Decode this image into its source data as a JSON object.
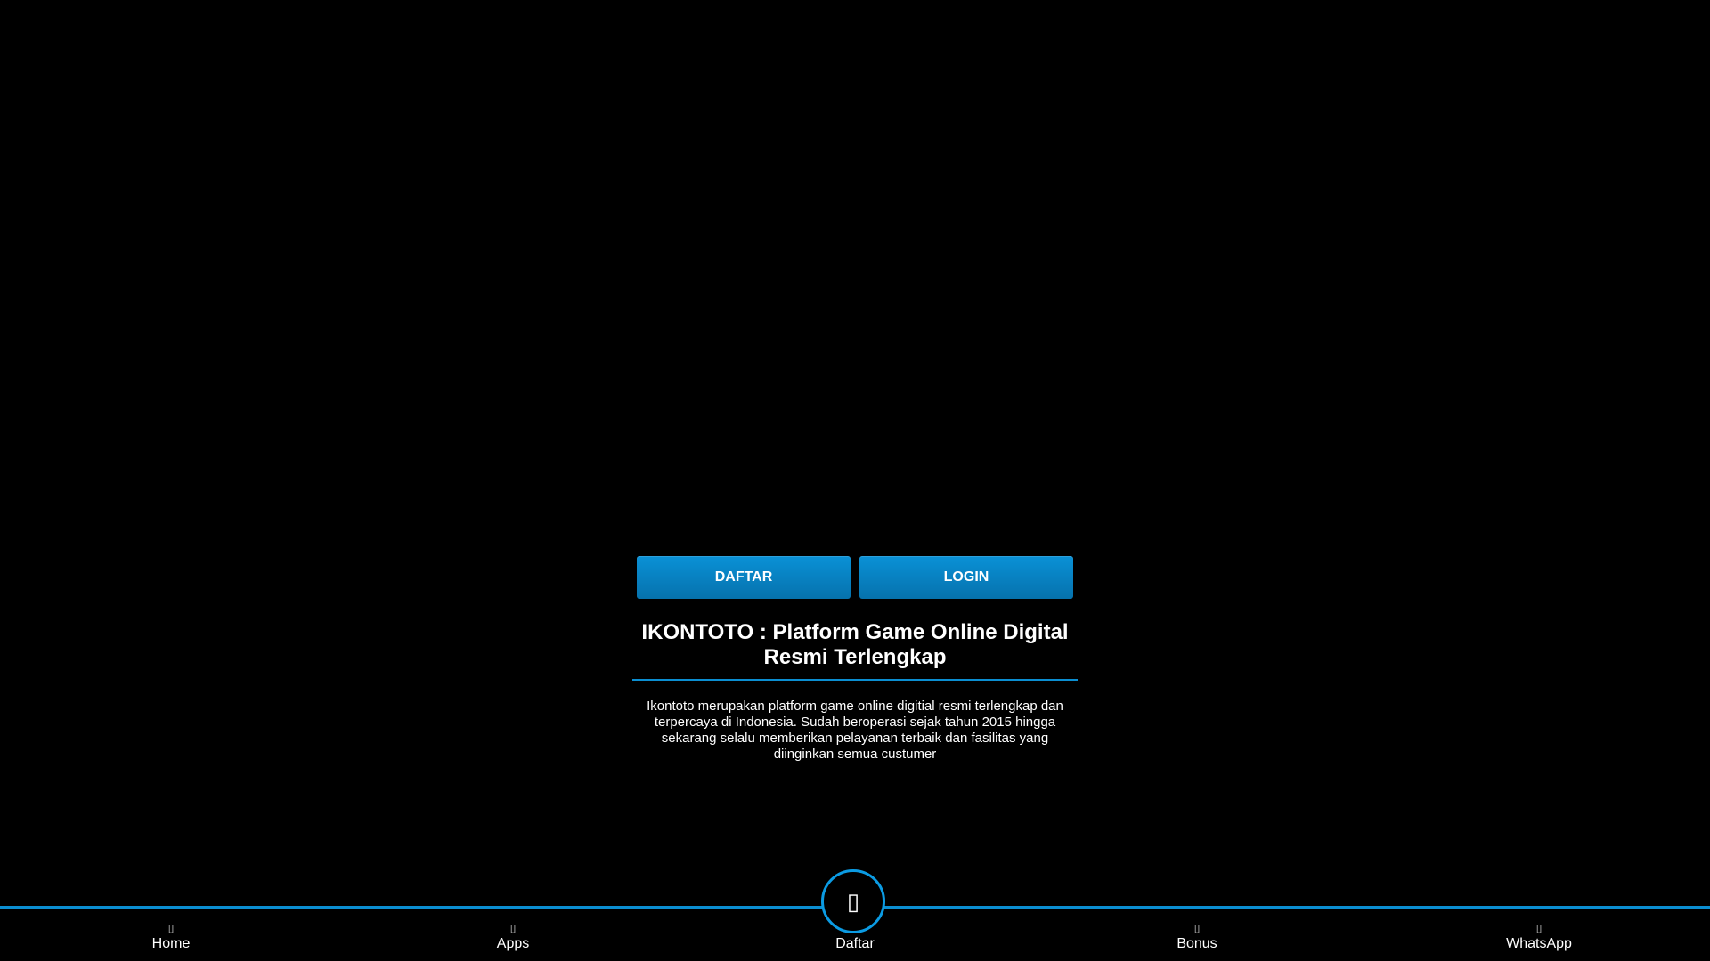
{
  "hero": {
    "buttons": {
      "register_label": "DAFTAR",
      "login_label": "LOGIN"
    }
  },
  "content": {
    "title": "IKONTOTO : Platform Game Online Digital Resmi Terlengkap",
    "description": "Ikontoto merupakan platform game online digitial resmi terlengkap dan terpercaya di Indonesia. Sudah beroperasi sejak tahun 2015 hingga sekarang selalu memberikan pelayanan terbaik dan fasilitas yang diinginkan semua custumer"
  },
  "bottom_nav": {
    "items": [
      {
        "label": "Home",
        "icon": "home-icon"
      },
      {
        "label": "Apps",
        "icon": "mobile-icon"
      },
      {
        "label": "Daftar",
        "icon": "user-plus-icon"
      },
      {
        "label": "Bonus",
        "icon": "gift-icon"
      },
      {
        "label": "WhatsApp",
        "icon": "whatsapp-icon"
      }
    ],
    "center_icon": "user-plus-icon"
  },
  "colors": {
    "background": "#000000",
    "accent": "#0b8ed1",
    "button": "#0881c2",
    "text": "#ffffff"
  }
}
